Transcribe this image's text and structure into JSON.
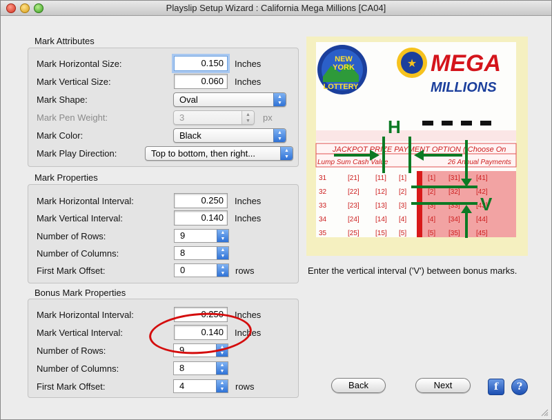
{
  "window": {
    "title": "Playslip Setup Wizard : California Mega Millions [CA04]"
  },
  "mark_attributes": {
    "title": "Mark Attributes",
    "horizontal_size_label": "Mark Horizontal Size:",
    "horizontal_size_value": "0.150",
    "vertical_size_label": "Mark Vertical Size:",
    "vertical_size_value": "0.060",
    "inches": "Inches",
    "shape_label": "Mark Shape:",
    "shape_value": "Oval",
    "pen_weight_label": "Mark Pen Weight:",
    "pen_weight_value": "3",
    "px": "px",
    "color_label": "Mark Color:",
    "color_value": "Black",
    "play_direction_label": "Mark Play Direction:",
    "play_direction_value": "Top to bottom, then right..."
  },
  "mark_properties": {
    "title": "Mark Properties",
    "h_interval_label": "Mark Horizontal Interval:",
    "h_interval_value": "0.250",
    "v_interval_label": "Mark Vertical Interval:",
    "v_interval_value": "0.140",
    "inches": "Inches",
    "rows_label": "Number of Rows:",
    "rows_value": "9",
    "cols_label": "Number of Columns:",
    "cols_value": "8",
    "offset_label": "First Mark Offset:",
    "offset_value": "0",
    "rows_unit": "rows"
  },
  "bonus_mark_properties": {
    "title": "Bonus Mark Properties",
    "h_interval_label": "Mark Horizontal Interval:",
    "h_interval_value": "0.250",
    "v_interval_label": "Mark Vertical Interval:",
    "v_interval_value": "0.140",
    "inches": "Inches",
    "rows_label": "Number of Rows:",
    "rows_value": "9",
    "cols_label": "Number of Columns:",
    "cols_value": "8",
    "offset_label": "First Mark Offset:",
    "offset_value": "4",
    "rows_unit": "rows"
  },
  "picture": {
    "ny_logo_lines": [
      "NEW",
      "YORK",
      "LOTTERY"
    ],
    "mega": "MEGA",
    "millions": "MILLIONS",
    "banner_text": "JACKPOT PRIZE PAYMENT OPTION ( Choose On",
    "banner_sub_left": "Lump Sum Cash Value",
    "banner_sub_right": "26 Annual Payments",
    "label_h": "H",
    "label_v": "V",
    "grid_numbers": [
      "31",
      "32",
      "33",
      "34",
      "35"
    ]
  },
  "instruction": "Enter the vertical interval ('V') between bonus marks.",
  "buttons": {
    "back": "Back",
    "next": "Next",
    "script_icon": "f",
    "help_icon": "?"
  }
}
